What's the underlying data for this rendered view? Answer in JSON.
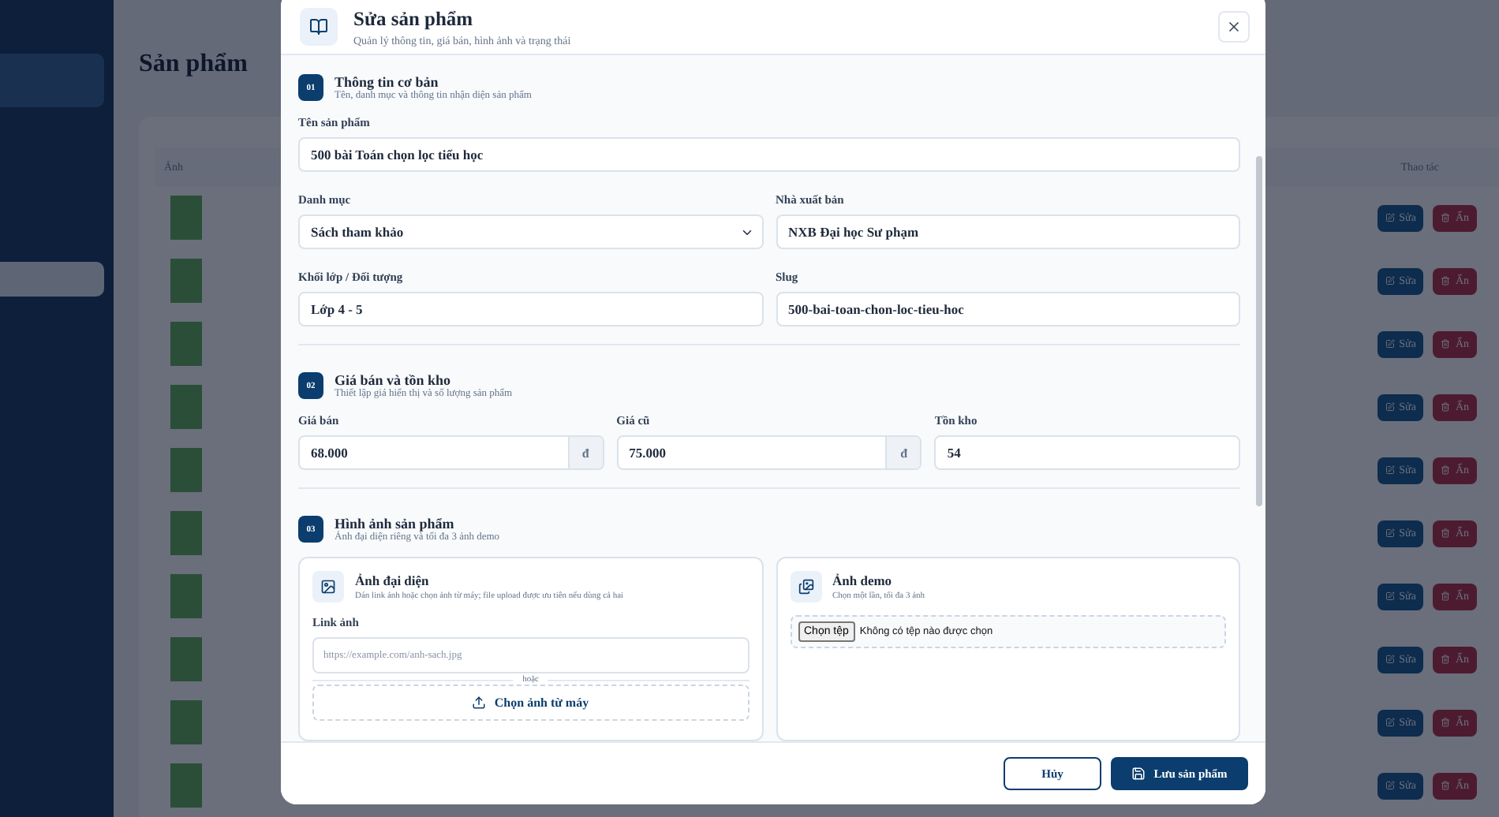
{
  "background_page": {
    "title": "Sản phẩm",
    "table": {
      "columns": [
        "Ảnh",
        "Thao tác"
      ],
      "rows": [
        {
          "edit": "Sửa",
          "hide": "Ẩn"
        },
        {
          "edit": "Sửa",
          "hide": "Ẩn"
        },
        {
          "edit": "Sửa",
          "hide": "Ẩn"
        },
        {
          "edit": "Sửa",
          "hide": "Ẩn"
        },
        {
          "edit": "Sửa",
          "hide": "Ẩn"
        },
        {
          "edit": "Sửa",
          "hide": "Ẩn"
        },
        {
          "edit": "Sửa",
          "hide": "Ẩn"
        },
        {
          "edit": "Sửa",
          "hide": "Ẩn"
        },
        {
          "edit": "Sửa",
          "hide": "Ẩn"
        },
        {
          "edit": "Sửa",
          "hide": "Ẩn"
        }
      ]
    }
  },
  "dialog": {
    "title": "Sửa sản phẩm",
    "subtitle": "Quản lý thông tin, giá bán, hình ảnh và trạng thái",
    "sections": [
      {
        "number": "01",
        "title": "Thông tin cơ bản",
        "subtitle": "Tên, danh mục và thông tin nhận diện sản phẩm",
        "rows": [
          [
            {
              "kind": "text",
              "label": "Tên sản phẩm",
              "value": "500 bài Toán chọn lọc tiểu học"
            }
          ],
          [
            {
              "kind": "select",
              "label": "Danh mục",
              "value": "Sách tham khảo"
            },
            {
              "kind": "text",
              "label": "Nhà xuất bản",
              "value": "NXB Đại học Sư phạm"
            }
          ],
          [
            {
              "kind": "text",
              "label": "Khối lớp / Đối tượng",
              "value": "Lớp 4 - 5"
            },
            {
              "kind": "text",
              "label": "Slug",
              "value": "500-bai-toan-chon-loc-tieu-hoc"
            }
          ]
        ]
      },
      {
        "number": "02",
        "title": "Giá bán và tồn kho",
        "subtitle": "Thiết lập giá hiển thị và số lượng sản phẩm",
        "rows": [
          [
            {
              "kind": "money",
              "label": "Giá bán",
              "value": "68.000",
              "suffix": "đ"
            },
            {
              "kind": "money",
              "label": "Giá cũ",
              "value": "75.000",
              "suffix": "đ"
            },
            {
              "kind": "text",
              "label": "Tồn kho",
              "value": "54"
            }
          ]
        ]
      }
    ],
    "images": {
      "number": "03",
      "title": "Hình ảnh sản phẩm",
      "subtitle": "Ảnh đại diện riêng và tối đa 3 ảnh demo",
      "cover": {
        "title": "Ảnh đại diện",
        "hint": "Dán link ảnh hoặc chọn ảnh từ máy; file upload được ưu tiên nếu dùng cả hai",
        "link_label": "Link ảnh",
        "placeholder": "https://example.com/anh-sach.jpg",
        "separator": "hoặc",
        "upload_button": "Chọn ảnh từ máy"
      },
      "demo": {
        "title": "Ảnh demo",
        "hint": "Chọn một lần, tối đa 3 ảnh",
        "file_button": "Chọn tệp",
        "file_status": "Không có tệp nào được chọn"
      }
    },
    "footer": {
      "cancel": "Hủy",
      "save": "Lưu sản phẩm"
    }
  }
}
